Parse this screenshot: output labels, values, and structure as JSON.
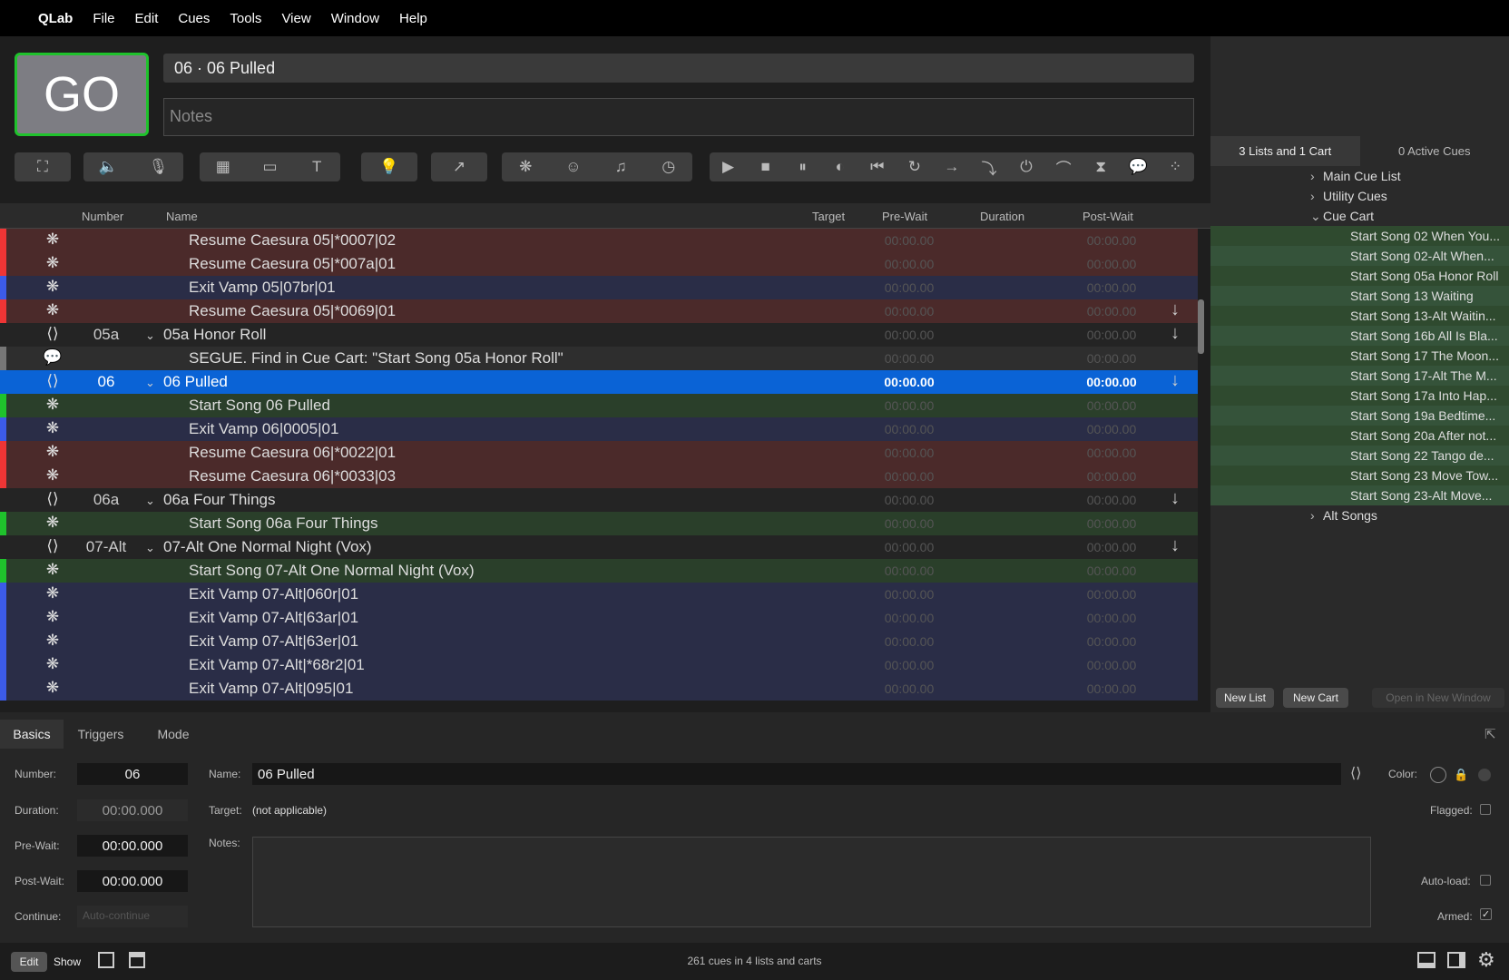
{
  "menubar": {
    "apple": "",
    "app": "QLab",
    "items": [
      "File",
      "Edit",
      "Cues",
      "Tools",
      "View",
      "Window",
      "Help"
    ]
  },
  "go_label": "GO",
  "current_cue": "06 · 06 Pulled",
  "notes_placeholder": "Notes",
  "toolbar_icons": [
    "fullscreen-icon",
    "audio-icon",
    "mic-icon",
    "video-icon",
    "camera-icon",
    "text-icon",
    "light-icon",
    "fade-icon",
    "network-icon",
    "midi-icon",
    "music-icon",
    "timecode-icon",
    "start-icon",
    "stop-icon",
    "pause-icon",
    "load-icon",
    "reset-icon",
    "devamp-icon",
    "goto-icon",
    "target-icon",
    "arm-icon",
    "disarm-icon",
    "wait-icon",
    "memo-icon",
    "script-icon"
  ],
  "colors": {
    "accent": "#0a63d6",
    "go_border": "#1fc22c",
    "red": "#ef3535",
    "blue": "#3c5be8",
    "green": "#1fc22c"
  },
  "side_tabs": [
    "3 Lists and 1 Cart",
    "0 Active Cues"
  ],
  "tree": [
    {
      "label": "Main Cue List",
      "indent": 1,
      "arrow": "›"
    },
    {
      "label": "Utility Cues",
      "indent": 1,
      "arrow": "›"
    },
    {
      "label": "Cue Cart",
      "indent": 1,
      "arrow": "⌄"
    },
    {
      "label": "Start Song 02 When You...",
      "indent": 2,
      "arrow": ""
    },
    {
      "label": "Start Song 02-Alt When...",
      "indent": 2,
      "arrow": ""
    },
    {
      "label": "Start Song 05a Honor Roll",
      "indent": 2,
      "arrow": ""
    },
    {
      "label": "Start Song 13 Waiting",
      "indent": 2,
      "arrow": ""
    },
    {
      "label": "Start Song 13-Alt Waitin...",
      "indent": 2,
      "arrow": ""
    },
    {
      "label": "Start Song 16b All Is Bla...",
      "indent": 2,
      "arrow": ""
    },
    {
      "label": "Start Song 17 The Moon...",
      "indent": 2,
      "arrow": ""
    },
    {
      "label": "Start Song 17-Alt The M...",
      "indent": 2,
      "arrow": ""
    },
    {
      "label": "Start Song 17a Into Hap...",
      "indent": 2,
      "arrow": ""
    },
    {
      "label": "Start Song 19a Bedtime...",
      "indent": 2,
      "arrow": ""
    },
    {
      "label": "Start Song 20a After not...",
      "indent": 2,
      "arrow": ""
    },
    {
      "label": "Start Song 22 Tango de...",
      "indent": 2,
      "arrow": ""
    },
    {
      "label": "Start Song 23 Move Tow...",
      "indent": 2,
      "arrow": ""
    },
    {
      "label": "Start Song 23-Alt Move...",
      "indent": 2,
      "arrow": ""
    },
    {
      "label": "Alt Songs",
      "indent": 1,
      "arrow": "›"
    }
  ],
  "side_buttons": [
    "New List",
    "New Cart",
    "Open in New Window"
  ],
  "columns": [
    "Number",
    "Name",
    "Target",
    "Pre-Wait",
    "Duration",
    "Post-Wait"
  ],
  "rows": [
    {
      "kind": "red",
      "icon": "network-icon",
      "num": "",
      "name": "Resume Caesura 05|*0007|02",
      "child": true,
      "pre": "00:00.00",
      "post": "00:00.00",
      "arrow": ""
    },
    {
      "kind": "red",
      "icon": "network-icon",
      "num": "",
      "name": "Resume Caesura 05|*007a|01",
      "child": true,
      "pre": "00:00.00",
      "post": "00:00.00",
      "arrow": ""
    },
    {
      "kind": "blue",
      "icon": "network-icon",
      "num": "",
      "name": "Exit Vamp 05|07br|01",
      "child": true,
      "pre": "00:00.00",
      "post": "00:00.00",
      "arrow": ""
    },
    {
      "kind": "red",
      "icon": "network-icon",
      "num": "",
      "name": "Resume Caesura 05|*0069|01",
      "child": true,
      "pre": "00:00.00",
      "post": "00:00.00",
      "arrow": "↓"
    },
    {
      "kind": "group",
      "icon": "group-icon",
      "num": "05a",
      "name": "05a Honor Roll",
      "child": false,
      "pre": "00:00.00",
      "post": "00:00.00",
      "arrow": "↓"
    },
    {
      "kind": "gray",
      "icon": "memo-icon",
      "num": "",
      "name": "SEGUE. Find in Cue Cart: \"Start Song 05a Honor Roll\"",
      "child": true,
      "pre": "00:00.00",
      "post": "00:00.00",
      "arrow": ""
    },
    {
      "kind": "selected",
      "icon": "group-icon",
      "num": "06",
      "name": "06 Pulled",
      "child": false,
      "pre": "00:00.00",
      "post": "00:00.00",
      "arrow": "↓"
    },
    {
      "kind": "green",
      "icon": "network-icon",
      "num": "",
      "name": "Start Song 06 Pulled",
      "child": true,
      "pre": "00:00.00",
      "post": "00:00.00",
      "arrow": ""
    },
    {
      "kind": "blue",
      "icon": "network-icon",
      "num": "",
      "name": "Exit Vamp 06|0005|01",
      "child": true,
      "pre": "00:00.00",
      "post": "00:00.00",
      "arrow": ""
    },
    {
      "kind": "red",
      "icon": "network-icon",
      "num": "",
      "name": "Resume Caesura 06|*0022|01",
      "child": true,
      "pre": "00:00.00",
      "post": "00:00.00",
      "arrow": ""
    },
    {
      "kind": "red",
      "icon": "network-icon",
      "num": "",
      "name": "Resume Caesura 06|*0033|03",
      "child": true,
      "pre": "00:00.00",
      "post": "00:00.00",
      "arrow": ""
    },
    {
      "kind": "group",
      "icon": "group-icon",
      "num": "06a",
      "name": "06a Four Things",
      "child": false,
      "pre": "00:00.00",
      "post": "00:00.00",
      "arrow": "↓"
    },
    {
      "kind": "green",
      "icon": "network-icon",
      "num": "",
      "name": "Start Song 06a Four Things",
      "child": true,
      "pre": "00:00.00",
      "post": "00:00.00",
      "arrow": ""
    },
    {
      "kind": "group",
      "icon": "group-icon",
      "num": "07-Alt",
      "name": "07-Alt One Normal Night (Vox)",
      "child": false,
      "pre": "00:00.00",
      "post": "00:00.00",
      "arrow": "↓"
    },
    {
      "kind": "green",
      "icon": "network-icon",
      "num": "",
      "name": "Start Song 07-Alt One Normal Night (Vox)",
      "child": true,
      "pre": "00:00.00",
      "post": "00:00.00",
      "arrow": ""
    },
    {
      "kind": "blue",
      "icon": "network-icon",
      "num": "",
      "name": "Exit Vamp 07-Alt|060r|01",
      "child": true,
      "pre": "00:00.00",
      "post": "00:00.00",
      "arrow": ""
    },
    {
      "kind": "blue",
      "icon": "network-icon",
      "num": "",
      "name": "Exit Vamp 07-Alt|63ar|01",
      "child": true,
      "pre": "00:00.00",
      "post": "00:00.00",
      "arrow": ""
    },
    {
      "kind": "blue",
      "icon": "network-icon",
      "num": "",
      "name": "Exit Vamp 07-Alt|63er|01",
      "child": true,
      "pre": "00:00.00",
      "post": "00:00.00",
      "arrow": ""
    },
    {
      "kind": "blue",
      "icon": "network-icon",
      "num": "",
      "name": "Exit Vamp 07-Alt|*68r2|01",
      "child": true,
      "pre": "00:00.00",
      "post": "00:00.00",
      "arrow": ""
    },
    {
      "kind": "blue",
      "icon": "network-icon",
      "num": "",
      "name": "Exit Vamp 07-Alt|095|01",
      "child": true,
      "pre": "00:00.00",
      "post": "00:00.00",
      "arrow": ""
    }
  ],
  "inspector": {
    "tabs": [
      "Basics",
      "Triggers",
      "Mode"
    ],
    "number_label": "Number:",
    "number": "06",
    "duration_label": "Duration:",
    "duration": "00:00.000",
    "prewait_label": "Pre-Wait:",
    "prewait": "00:00.000",
    "postwait_label": "Post-Wait:",
    "postwait": "00:00.000",
    "continue_label": "Continue:",
    "continue": "Auto-continue",
    "name_label": "Name:",
    "name": "06 Pulled",
    "target_label": "Target:",
    "target": "(not applicable)",
    "notes_label": "Notes:",
    "color_label": "Color:",
    "flagged_label": "Flagged:",
    "autoload_label": "Auto-load:",
    "armed_label": "Armed:"
  },
  "status": {
    "edit": "Edit",
    "show": "Show",
    "text": "261 cues in 4 lists and carts"
  }
}
